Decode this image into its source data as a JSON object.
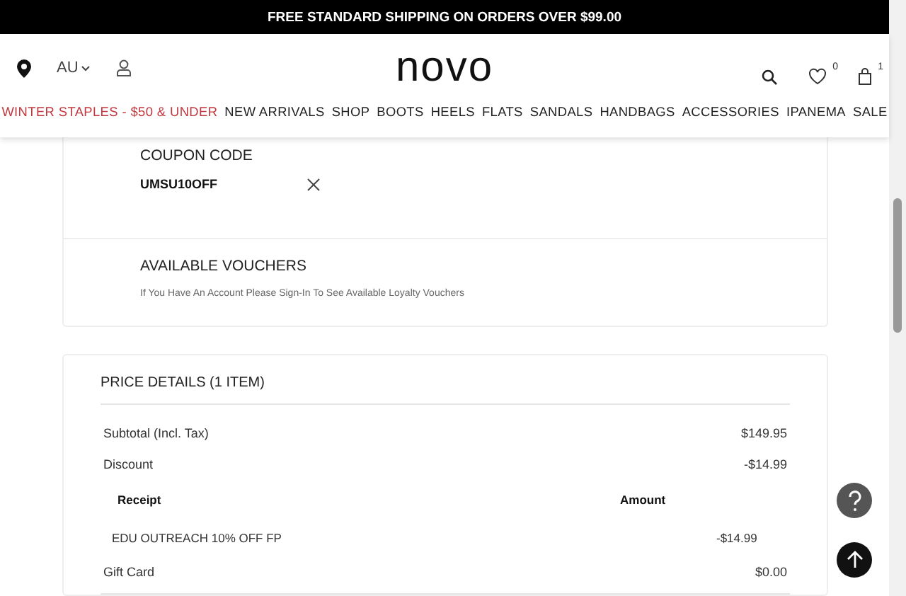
{
  "banner": "FREE STANDARD SHIPPING ON ORDERS OVER $99.00",
  "header": {
    "country": "AU",
    "logo": "novo",
    "wishlist_count": "0",
    "cart_count": "1"
  },
  "nav": [
    {
      "label": "WINTER STAPLES - $50 & UNDER",
      "kind": "promo"
    },
    {
      "label": "NEW ARRIVALS",
      "kind": "normal"
    },
    {
      "label": "SHOP",
      "kind": "normal"
    },
    {
      "label": "BOOTS",
      "kind": "normal"
    },
    {
      "label": "HEELS",
      "kind": "normal"
    },
    {
      "label": "FLATS",
      "kind": "normal"
    },
    {
      "label": "SANDALS",
      "kind": "normal"
    },
    {
      "label": "HANDBAGS",
      "kind": "normal"
    },
    {
      "label": "ACCESSORIES",
      "kind": "normal"
    },
    {
      "label": "IPANEMA",
      "kind": "normal"
    },
    {
      "label": "SALE",
      "kind": "normal"
    }
  ],
  "coupon": {
    "title": "COUPON CODE",
    "code": "UMSU10OFF"
  },
  "vouchers": {
    "title": "AVAILABLE VOUCHERS",
    "note": "If You Have An Account Please Sign-In To See Available Loyalty Vouchers"
  },
  "price_details": {
    "title": "PRICE DETAILS (1 ITEM)",
    "rows": [
      {
        "label": "Subtotal (Incl. Tax)",
        "value": "$149.95"
      },
      {
        "label": "Discount",
        "value": "-$14.99"
      }
    ],
    "receipt_columns": [
      "Receipt",
      "Amount"
    ],
    "receipt_rows": [
      {
        "name": "EDU OUTREACH 10% OFF FP",
        "amount": "-$14.99"
      }
    ],
    "after_rows": [
      {
        "label": "Gift Card",
        "value": "$0.00"
      }
    ]
  }
}
